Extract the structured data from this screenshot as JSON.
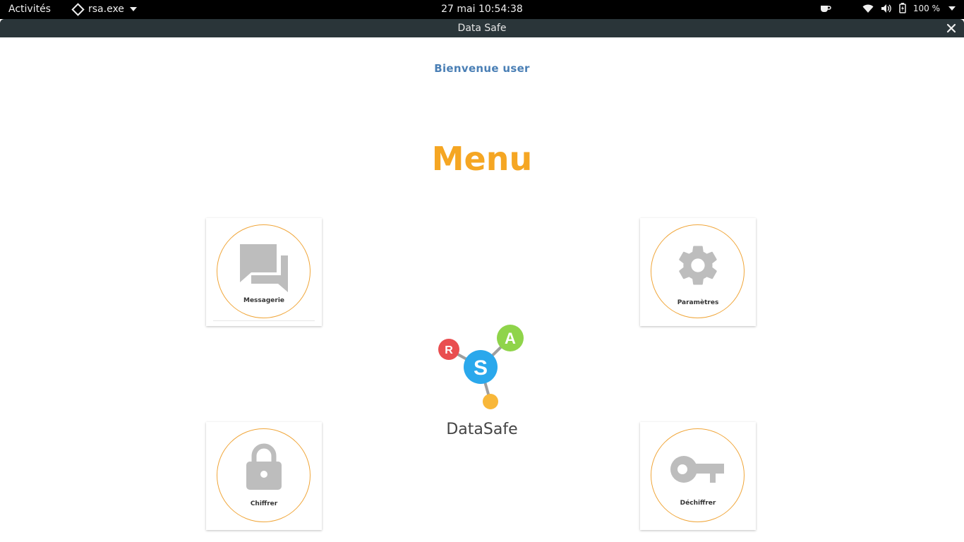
{
  "topbar": {
    "activities": "Activités",
    "app_name": "rsa.exe",
    "clock": "27 mai  10:54:38",
    "battery": "100 %"
  },
  "window": {
    "title": "Data Safe"
  },
  "content": {
    "welcome": "Bienvenue  user",
    "menu_title": "Menu",
    "cards": {
      "messagerie": "Messagerie",
      "parametres": "Paramètres",
      "chiffrer": "Chiffrer",
      "dechiffrer": "Déchiffrer"
    },
    "logo_letters": {
      "r": "R",
      "s": "S",
      "a": "A"
    },
    "brand": "DataSafe"
  },
  "colors": {
    "accent_orange": "#f5a623",
    "ring_orange": "#f0a63a",
    "welcome_blue": "#4a7fb5",
    "icon_gray": "#bdbdbd",
    "logo_red": "#e94e50",
    "logo_blue": "#2aa8ec",
    "logo_green": "#8fd44a",
    "logo_yellow": "#f8b739"
  },
  "icons": [
    "chat-icon",
    "gear-icon",
    "lock-icon",
    "key-icon",
    "coffee-icon",
    "wifi-icon",
    "volume-icon",
    "battery-icon",
    "close-icon"
  ]
}
